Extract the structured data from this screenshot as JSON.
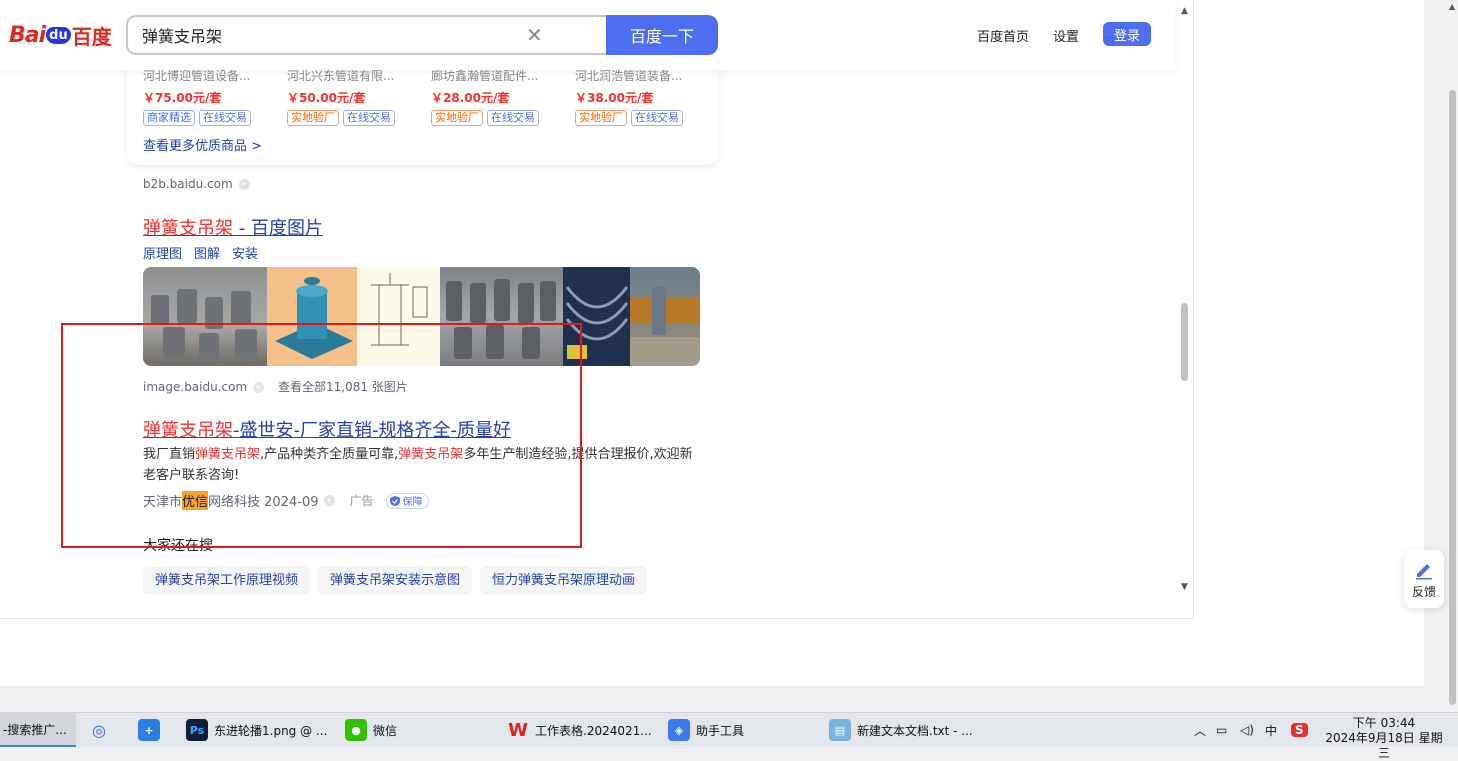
{
  "browser": {
    "logo": {
      "bai": "Bai",
      "du": "du",
      "cn": "百度"
    },
    "search": {
      "value": "弹簧支吊架",
      "button": "百度一下"
    },
    "nav": {
      "home": "百度首页",
      "settings": "设置",
      "login": "登录"
    }
  },
  "shop_card": {
    "products": [
      {
        "name": "河北博迎管道设备...",
        "price": "￥75.00元/套",
        "tags": [
          "商家精选",
          "在线交易"
        ]
      },
      {
        "name": "河北兴东管道有限...",
        "price": "￥50.00元/套",
        "tags": [
          "实地验厂",
          "在线交易"
        ]
      },
      {
        "name": "廊坊鑫瀚管道配件...",
        "price": "￥28.00元/套",
        "tags": [
          "实地验厂",
          "在线交易"
        ]
      },
      {
        "name": "河北润浩管道装备...",
        "price": "￥38.00元/套",
        "tags": [
          "实地验厂",
          "在线交易"
        ]
      }
    ],
    "more": "查看更多优质商品 >",
    "source": "b2b.baidu.com"
  },
  "image_result": {
    "title_red": "弹簧支吊架",
    "title_rest": " - 百度图片",
    "sublinks": [
      "原理图",
      "图解",
      "安装"
    ],
    "source": "image.baidu.com",
    "count_text": "查看全部11,081 张图片"
  },
  "ad_result": {
    "title_red": "弹簧支吊架",
    "title_rest": "-盛世安-厂家直销-规格齐全-质量好",
    "desc": {
      "p1": "我厂直销",
      "k1": "弹簧支吊架",
      "p2": ",产品种类齐全质量可靠,",
      "k2": "弹簧支吊架",
      "p3": "多年生产制造经验,提供合理报价,欢迎新老客户联系咨询!"
    },
    "source_pre": "天津市",
    "source_hl": "优信",
    "source_post": "网络科技 2024-09",
    "ad_label": "广告",
    "badge": "保障"
  },
  "related": {
    "title": "大家还在搜",
    "chips": [
      "弹簧支吊架工作原理视频",
      "弹簧支吊架安装示意图",
      "恒力弹簧支吊架原理动画"
    ]
  },
  "feedback": "反馈",
  "taskbar": {
    "items": [
      "-搜索推广...",
      "东进轮播1.png @ ...",
      "微信",
      "工作表格.2024021...",
      "助手工具",
      "新建文本文档.txt - ..."
    ],
    "tray_ime": "中",
    "time": "下午 03:44",
    "date": "2024年9月18日 星期三"
  },
  "colors": {
    "accent": "#4e6ef2",
    "link": "#2440b3",
    "red": "#f73131",
    "box": "#e3181f"
  }
}
